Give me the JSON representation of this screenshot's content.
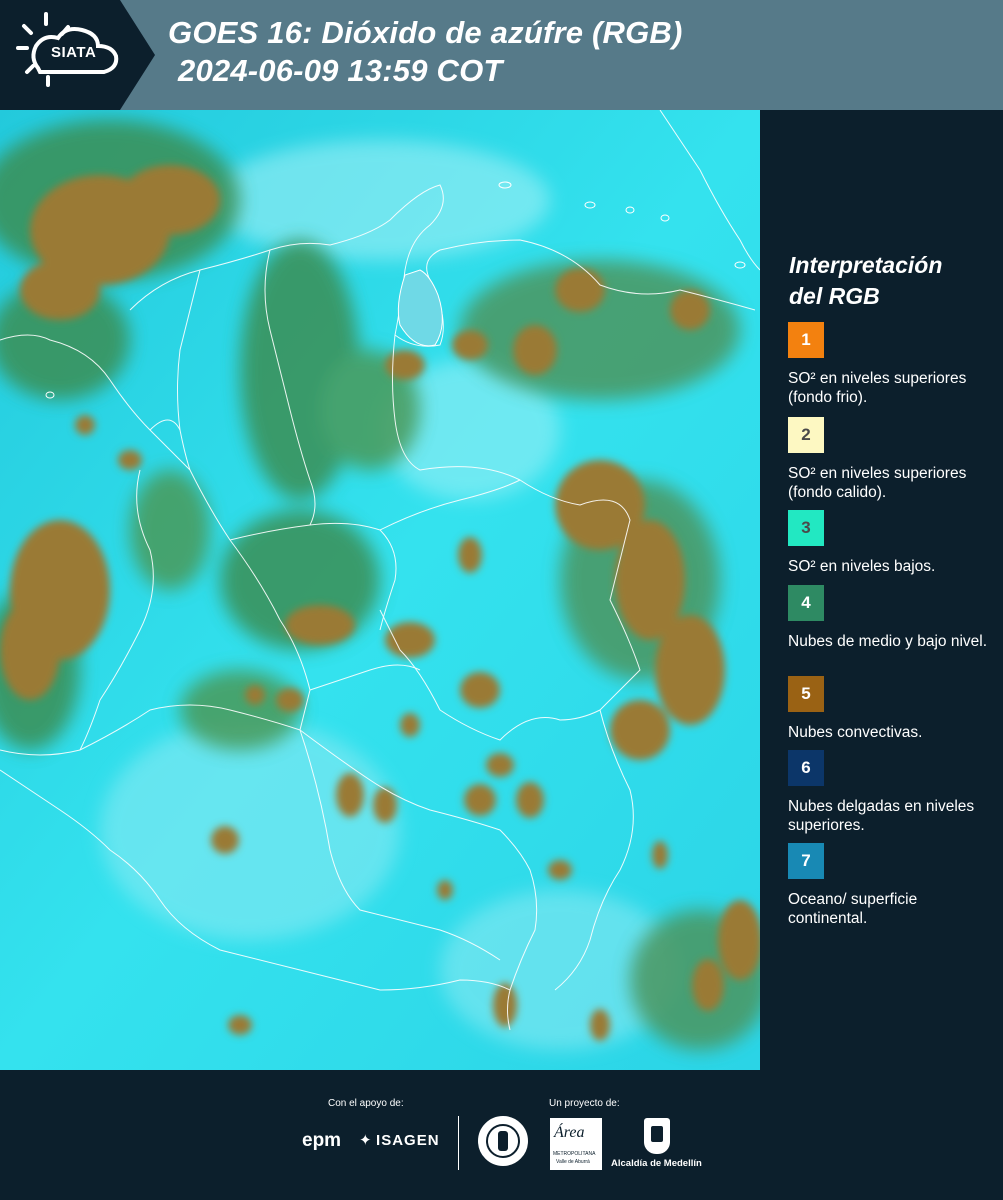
{
  "header": {
    "logo_text": "SIATA",
    "title_line1": "GOES 16: Dióxido de azúfre (RGB)",
    "title_line2": "2024-06-09 13:59 COT"
  },
  "legend": {
    "title_line1": "Interpretación",
    "title_line2": "del RGB",
    "items": [
      {
        "number": "1",
        "color": "#f3810f",
        "text": "SO² en niveles superiores (fondo frio)."
      },
      {
        "number": "2",
        "color": "#fdf8c2",
        "text": "SO² en niveles superiores (fondo calido)."
      },
      {
        "number": "3",
        "color": "#22e8c2",
        "text": "SO² en niveles bajos."
      },
      {
        "number": "4",
        "color": "#2e8a63",
        "text": "Nubes de medio y bajo nivel."
      },
      {
        "number": "5",
        "color": "#9a6214",
        "text": "Nubes convectivas."
      },
      {
        "number": "6",
        "color": "#0c3669",
        "text": "Nubes delgadas en niveles superiores."
      },
      {
        "number": "7",
        "color": "#1889b4",
        "text": "Oceano/ superficie continental."
      }
    ]
  },
  "map": {
    "background_color": "#2ad8e6",
    "cloud_color": "#9a7a35",
    "mid_cloud_color": "#3a8f5a",
    "border_color": "#ffffff"
  },
  "footer": {
    "support_label": "Con el apoyo de:",
    "project_label": "Un proyecto de:",
    "sponsor1": "epm",
    "sponsor2": "ISAGEN",
    "partner1": "METROPOLITANA",
    "partner1_sub": "Valle de Aburrá",
    "partner1_script": "Área",
    "partner2": "Alcaldía de Medellín"
  }
}
